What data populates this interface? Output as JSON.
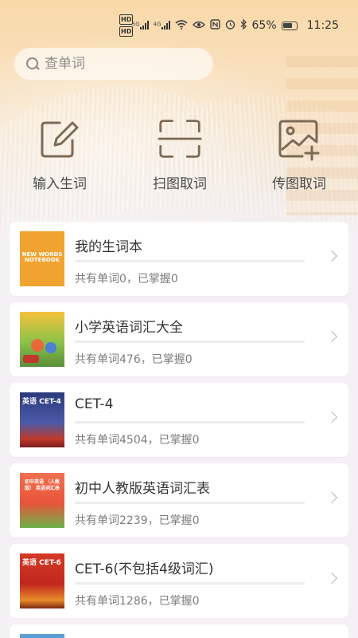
{
  "status": {
    "net_labels": [
      "HD",
      "HD"
    ],
    "sig_labels": [
      "5G",
      "4G"
    ],
    "battery": "65%",
    "time": "11:25"
  },
  "search": {
    "placeholder": "查单词"
  },
  "actions": [
    {
      "label": "输入生词",
      "icon": "edit-icon"
    },
    {
      "label": "扫图取词",
      "icon": "scan-icon"
    },
    {
      "label": "传图取词",
      "icon": "upload-image-icon"
    }
  ],
  "books": [
    {
      "title": "我的生词本",
      "count": "共有单词0，已掌握0",
      "cover_text": "NEW WORDS NOTEBOOK",
      "cover_color": "#f0a330",
      "progress": 0
    },
    {
      "title": "小学英语词汇大全",
      "count": "共有单词476，已掌握0",
      "cover_color": "#f3b62c",
      "progress": 0
    },
    {
      "title": "CET-4",
      "count": "共有单词4504，已掌握0",
      "cover_text": "英语 CET-4",
      "cover_color": "#3a4a8c",
      "progress": 0
    },
    {
      "title": "初中人教版英语词汇表",
      "count": "共有单词2239，已掌握0",
      "cover_text": "初中英语 （人教版） 英语词汇表",
      "cover_color": "#e65b3c",
      "progress": 0
    },
    {
      "title": "CET-6(不包括4级词汇)",
      "count": "共有单词1286，已掌握0",
      "cover_text": "英语 CET-6",
      "cover_color": "#c1281e",
      "progress": 0
    }
  ]
}
